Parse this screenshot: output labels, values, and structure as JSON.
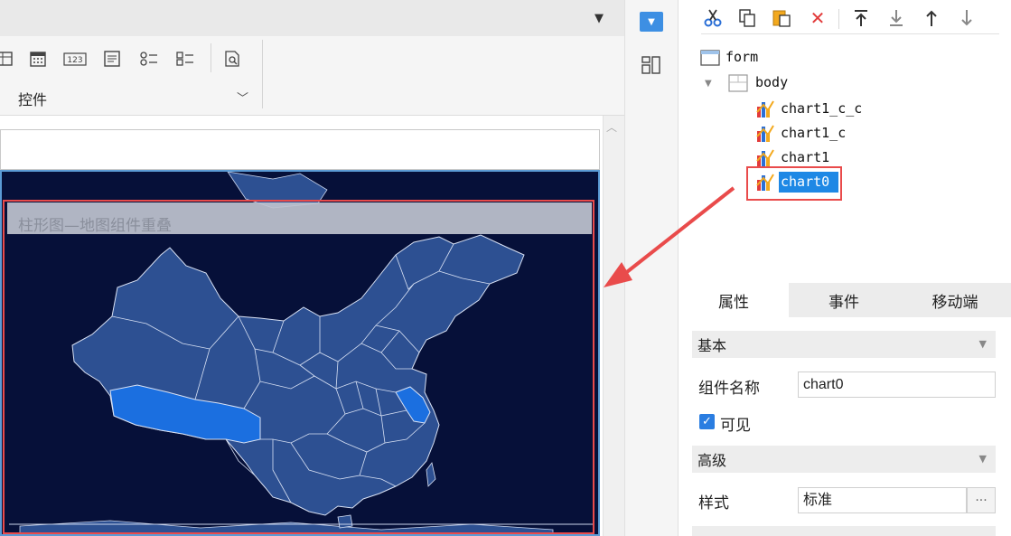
{
  "ribbon": {
    "group_label": "控件",
    "tools": [
      {
        "icon": "grid-table-icon"
      },
      {
        "icon": "calendar-icon"
      },
      {
        "icon": "number-field-icon",
        "text": "123"
      },
      {
        "icon": "textarea-icon"
      },
      {
        "icon": "radio-group-icon"
      },
      {
        "icon": "checkbox-group-icon"
      },
      {
        "icon": "search-preview-icon"
      }
    ]
  },
  "canvas": {
    "chart_title": "柱形图—地图组件重叠"
  },
  "map": {
    "base_fill": "#2d5092",
    "highlight_fill": "#1b6fe0",
    "background": "#061039",
    "highlighted_regions": [
      "xizang",
      "jiangsu"
    ]
  },
  "toolbar": {
    "icons": [
      "cut-icon",
      "copy-icon",
      "paste-icon",
      "delete-icon",
      "move-top-icon",
      "move-bottom-icon",
      "move-up-icon",
      "move-down-icon"
    ]
  },
  "tree": {
    "root": "form",
    "body": "body",
    "children": [
      "chart1_c_c",
      "chart1_c",
      "chart1",
      "chart0"
    ],
    "selected": "chart0"
  },
  "tabs": [
    "属性",
    "事件",
    "移动端"
  ],
  "props": {
    "section_basic": "基本",
    "name_label": "组件名称",
    "name_value": "chart0",
    "visible_label": "可见",
    "visible_checked": true,
    "section_advanced": "高级",
    "style_label": "样式",
    "style_value": "标准",
    "ellipsis": "···"
  },
  "colors": {
    "accent": "#1e88e5",
    "callout": "#e94b4b"
  }
}
